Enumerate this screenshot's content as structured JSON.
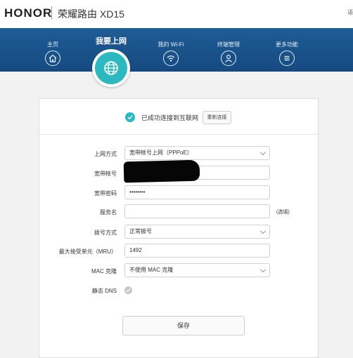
{
  "header": {
    "brand": "HONOR",
    "device": "荣耀路由 XD15",
    "corner": "语"
  },
  "nav": {
    "items": [
      {
        "label": "主页",
        "icon": "home-icon"
      },
      {
        "label": "我的 Wi-Fi",
        "icon": "wifi-icon"
      },
      {
        "label": "终端管理",
        "icon": "user-icon"
      },
      {
        "label": "更多功能",
        "icon": "menu-icon"
      }
    ],
    "active": {
      "label": "我要上网",
      "icon": "globe-icon"
    }
  },
  "status": {
    "text": "已成功连接到互联网",
    "reconnect_label": "重新连接"
  },
  "form": {
    "connection_type": {
      "label": "上网方式",
      "value": "宽带帐号上网（PPPoE）"
    },
    "account": {
      "label": "宽带帐号",
      "value": ""
    },
    "password": {
      "label": "宽带密码",
      "value": "••••••••"
    },
    "service_name": {
      "label": "服务名",
      "value": "",
      "hint": "(选填)"
    },
    "dial_mode": {
      "label": "拨号方式",
      "value": "正常拨号"
    },
    "mru": {
      "label": "最大接受单元（MRU）",
      "value": "1492"
    },
    "mac_clone": {
      "label": "MAC 克隆",
      "value": "不使用 MAC 克隆"
    },
    "static_dns": {
      "label": "静态 DNS"
    }
  },
  "actions": {
    "save_label": "保存"
  },
  "colors": {
    "nav_bg": "#1a5288",
    "accent": "#2bb9bf"
  }
}
